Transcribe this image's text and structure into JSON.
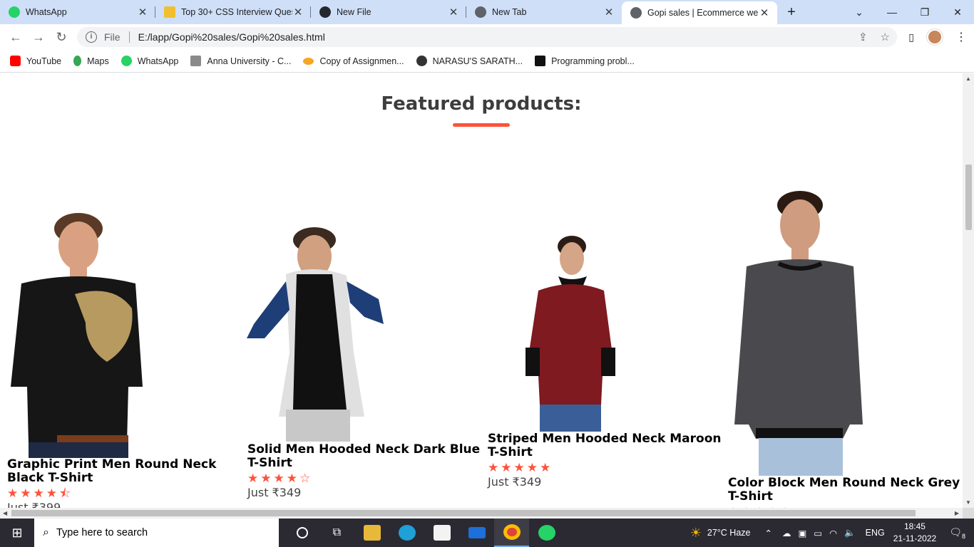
{
  "browser": {
    "tabs": [
      {
        "title": "WhatsApp",
        "color": "#25d366"
      },
      {
        "title": "Top 30+ CSS Interview Quest",
        "color": "#f0c030"
      },
      {
        "title": "New File",
        "color": "#24292e"
      },
      {
        "title": "New Tab",
        "color": "#5f6368"
      },
      {
        "title": "Gopi sales | Ecommerce webs",
        "color": "#5f6368"
      }
    ],
    "address": {
      "scheme_label": "File",
      "url": "E:/lapp/Gopi%20sales/Gopi%20sales.html"
    },
    "bookmarks": [
      {
        "label": "YouTube",
        "color": "#ff0000"
      },
      {
        "label": "Maps",
        "color": "#34a853"
      },
      {
        "label": "WhatsApp",
        "color": "#25d366"
      },
      {
        "label": "Anna University - C...",
        "color": "#8a8a8a"
      },
      {
        "label": "Copy of Assignmen...",
        "color": "#f5a623"
      },
      {
        "label": "NARASU'S SARATH...",
        "color": "#333333"
      },
      {
        "label": "Programming probl...",
        "color": "#111111"
      }
    ]
  },
  "page": {
    "heading": "Featured products:",
    "accent": "#ff523b",
    "products": [
      {
        "name": "Graphic Print Men Round Neck Black T-Shirt",
        "stars": "★★★★⯪",
        "price": "Just ₹399"
      },
      {
        "name": "Solid Men Hooded Neck Dark Blue T-Shirt",
        "stars": "★★★★☆",
        "price": "Just ₹349"
      },
      {
        "name": "Striped Men Hooded Neck Maroon T-Shirt",
        "stars": "★★★★★",
        "price": "Just ₹349"
      },
      {
        "name": "Color Block Men Round Neck Grey T-Shirt",
        "stars": "★★★★★",
        "price": ""
      }
    ]
  },
  "taskbar": {
    "search_placeholder": "Type here to search",
    "weather": "27°C  Haze",
    "language": "ENG",
    "time": "18:45",
    "date": "21-11-2022",
    "notifications": "8"
  }
}
